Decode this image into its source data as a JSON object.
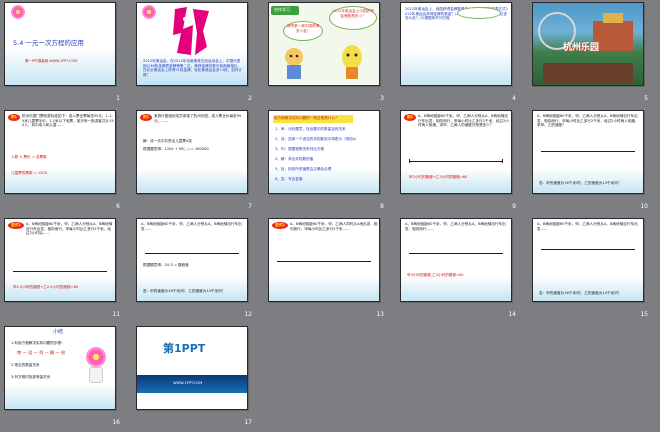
{
  "slides": [
    {
      "num": "1",
      "title": "5.4 一元一次方程的应用",
      "caption": "第一PPT模板网-WWW.1PPT.COM"
    },
    {
      "num": "2",
      "text": "2012年奥运会，在2012年伦敦奥林匹克运动会上，中国代表团以38枚金牌居奖牌榜第二位。荣获金牌总数与前两届相比，在北京奥运会上获得51枚金牌，较伦敦奥运会多13枚。如何计算？"
    },
    {
      "num": "3",
      "label": "合作学习",
      "bubble1": "请举第一奥中国获得多少金？",
      "bubble2": "2012年奥运会上中国获得金牌数是多少？"
    },
    {
      "num": "4",
      "text": "2012年奥运会上，我国获得金牌数是多少？(1)用哪些量表达式2012年奥运会获得金牌的数量？(2)如果设你的方程未知数，应该怎么设？(3)根据条件列方程"
    },
    {
      "num": "5",
      "caption": "杭州乐园"
    },
    {
      "num": "6",
      "tag": "例1",
      "text": "杭州乐园门票收费标准如下：成人票全票每张95元、1-1.5米儿童票半价，1.2米以下免票。某天有一批游客共计150人，其中成人和儿童……",
      "line1": "人数 × 票价 = 总票款",
      "line2": "儿童票的票款 = 1200"
    },
    {
      "num": "7",
      "tag": "例1",
      "text": "某旅行团组织成员参观了杭州乐园，成人票全价每张95元，……",
      "line1": "解：设一天中共售出儿童票x张",
      "line2": "根据题意得：120x + 95(...) = 160000"
    },
    {
      "num": "8",
      "title": "用方程解决实际问题的一般过程是什么？",
      "steps": [
        "1、审：分析题意，找出题中的数量及其关系",
        "2、设：选择一个适当的未知数用字母表示（例如x）",
        "3、列：根据相等关系列出方程",
        "4、解：求出未知数的值",
        "5、检：检验所求值是否正确及合理",
        "6、答：写出答案"
      ]
    },
    {
      "num": "9",
      "tag": "例2",
      "text": "A、B两地相距60千米，甲、乙两人分别从A、B两地骑自行车出发，相向而行，甲每小时比乙多行2千米，经过2小时两人相遇，求甲、乙两人的速度分别是多少？",
      "eq": "甲2小时的路程+乙2小时的路程=60"
    },
    {
      "num": "10",
      "text": "A、B两地相距60千米，甲、乙两人分别从A、B两地骑自行车出发，相向而行，甲每小时比乙多行2千米，经过2小时两人相遇，求甲、乙的速度？",
      "eq": "答：甲的速度为16千米/时，乙的速度为14千米/时"
    },
    {
      "num": "11",
      "tag": "变式1",
      "text": "A、B两地相距60千米，甲、乙两人分别从A、B两地骑自行车出发，相向而行，甲每小时比乙多行2千米，经过2小时后……",
      "eq": "甲2.5小时的路程+乙2.5小时的路程=60"
    },
    {
      "num": "12",
      "text": "A、B两地相距60千米，甲、乙两人分别从A、B两地骑自行车出发……",
      "eq1": "根据题意得：20-3 = 路程差",
      "eq2": "答：甲的速度为16千米/时，乙的速度为14千米/时"
    },
    {
      "num": "13",
      "tag": "变式2",
      "text": "A、B两地相距60千米，甲、乙两人同时从A地出发，相向而行，甲每小时比乙多行2千米……"
    },
    {
      "num": "14",
      "text": "A、B两地相距60千米，甲、乙两人分别从A、B两地骑自行车出发，相向而行……",
      "eq": "甲3小时的路程-乙3小时的路程=60"
    },
    {
      "num": "15",
      "text": "A、B两地相距60千米，甲、乙两人分别从A、B两地骑自行车出发……",
      "eq": "答：甲的速度为16千米/时，乙的速度为14千米/时"
    },
    {
      "num": "16",
      "title": "小结",
      "lines": [
        "1.利用方程解决实际问题的步骤：",
        "审 — 设 — 列 — 解 — 检",
        "2.常见的数量关系",
        "3.列方程时找准等量关系"
      ]
    },
    {
      "num": "17",
      "brand": "第1PPT",
      "sub": "WWW.1PPT.COM"
    }
  ]
}
